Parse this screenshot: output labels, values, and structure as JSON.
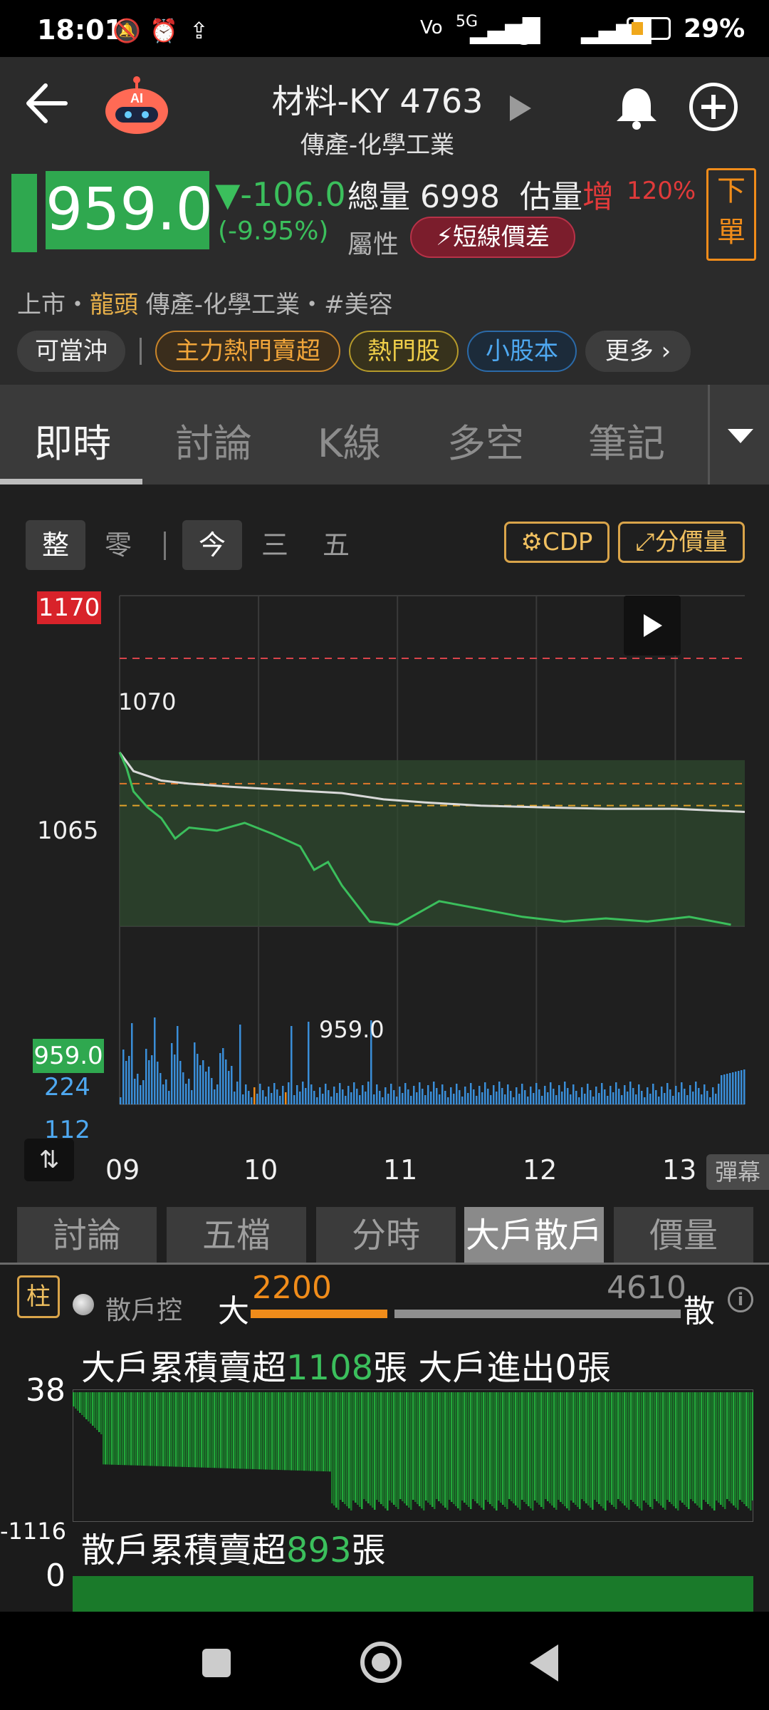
{
  "status_bar": {
    "time": "18:01",
    "battery_level": 0.29,
    "battery_text": "29%",
    "network": "5G"
  },
  "header": {
    "title": "材料-KY 4763",
    "subtitle": "傳產-化學工業",
    "price": "959.0",
    "change": "-106.0",
    "change_pct": "(-9.95%)",
    "volume_label": "總量 6998",
    "estimate_label": "估量",
    "estimate_trend": "增",
    "estimate_pct": "120%",
    "order_button": "下\n單",
    "attr_label": "屬性",
    "attr_badge": "短線價差",
    "breadcrumb_prefix": "上市・",
    "breadcrumb_lead": "龍頭",
    "breadcrumb_rest": " 傳產-化學工業・#美容",
    "tags": [
      "可當沖",
      "主力熱門賣超",
      "熱門股",
      "小股本",
      "更多"
    ]
  },
  "main_tabs": [
    "即時",
    "討論",
    "K線",
    "多空",
    "筆記"
  ],
  "chart_controls": {
    "segments": [
      "整",
      "零",
      "今",
      "三",
      "五"
    ],
    "cdp_label": "CDP",
    "price_volume_label": "分價量"
  },
  "chart_data": {
    "type": "line",
    "y_labels": [
      "1170",
      "1065",
      "959.0"
    ],
    "volume_labels": [
      "224",
      "112"
    ],
    "open_annotation": "1070",
    "low_annotation": "959.0",
    "x_labels": [
      "09",
      "10",
      "11",
      "12",
      "13"
    ],
    "ylim": [
      959,
      1170
    ],
    "reference_price": 1065,
    "limit_up": 1170,
    "limit_down": 959,
    "lines": {
      "dashed_red": 1130,
      "dashed_orange_1": 1050,
      "dashed_orange_2": 1036
    },
    "series": [
      {
        "color": "#3bbf5c",
        "x": [
          9.0,
          9.05,
          9.1,
          9.2,
          9.3,
          9.4,
          9.5,
          9.7,
          9.9,
          10.1,
          10.3,
          10.4,
          10.5,
          10.6,
          10.8,
          11.0,
          11.3,
          11.6,
          11.9,
          12.2,
          12.5,
          12.8,
          13.1,
          13.4
        ],
        "values": [
          1070,
          1060,
          1045,
          1035,
          1028,
          1015,
          1022,
          1020,
          1025,
          1018,
          1010,
          995,
          1000,
          985,
          962,
          960,
          975,
          970,
          965,
          962,
          964,
          962,
          965,
          960
        ]
      },
      {
        "color": "#d9d9d9",
        "x": [
          9.0,
          9.1,
          9.3,
          9.5,
          9.8,
          10.2,
          10.6,
          10.9,
          11.2,
          11.6,
          12.0,
          12.5,
          13.0,
          13.5
        ],
        "values": [
          1070,
          1058,
          1052,
          1050,
          1048,
          1046,
          1044,
          1040,
          1038,
          1036,
          1035,
          1034,
          1034,
          1032
        ]
      }
    ],
    "popup_label": "彈幕"
  },
  "sub_tabs": [
    "討論",
    "五檔",
    "分時",
    "大戶散戶",
    "價量"
  ],
  "holders": {
    "pillar_label": "柱",
    "retail_control": "散戶控",
    "big_label": "大",
    "big_value": "2200",
    "small_value": "4610",
    "small_label": "散",
    "big_ratio": 0.32,
    "headline1_prefix": "大戶累積賣超",
    "headline1_num": "1108",
    "headline1_suffix": "張  大戶進出0張",
    "top_y": "38",
    "bottom_y": "-1116",
    "headline2_prefix": "散戶累積賣超",
    "headline2_num": "893",
    "headline2_suffix": "張",
    "zero_y": "0"
  }
}
